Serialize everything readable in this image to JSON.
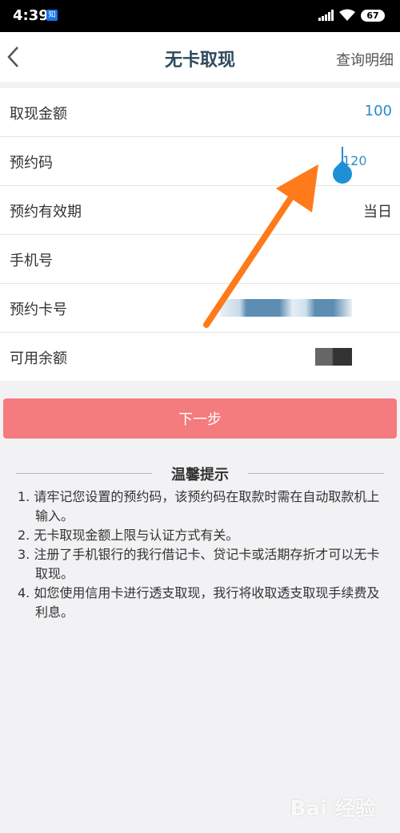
{
  "status_bar": {
    "time": "4:39",
    "app_badge": "知",
    "battery": "67"
  },
  "nav": {
    "title": "无卡取现",
    "detail_link": "查询明细"
  },
  "form": {
    "amount": {
      "label": "取现金额",
      "value": "100"
    },
    "code": {
      "label": "预约码",
      "value": "120"
    },
    "validity": {
      "label": "预约有效期",
      "value": "当日"
    },
    "phone": {
      "label": "手机号"
    },
    "card": {
      "label": "预约卡号"
    },
    "balance": {
      "label": "可用余额"
    }
  },
  "next_button": "下一步",
  "tips": {
    "title": "温馨提示",
    "items": [
      "1. 请牢记您设置的预约码，该预约码在取款时需在自动取款机上输入。",
      "2. 无卡取现金额上限与认证方式有关。",
      "3. 注册了手机银行的我行借记卡、贷记卡或活期存折才可以无卡取现。",
      "4. 如您使用信用卡进行透支取现，我行将收取透支取现手续费及利息。"
    ]
  },
  "watermark": "Bai 经验",
  "colors": {
    "accent_blue": "#2b88c9",
    "button": "#f47b7e",
    "arrow": "#ff7a1a"
  }
}
